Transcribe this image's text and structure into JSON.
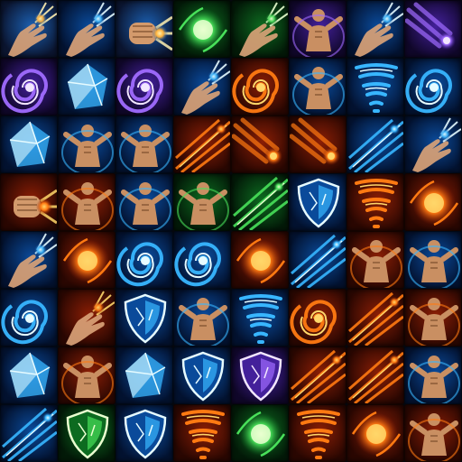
{
  "atlas": {
    "columns": 8,
    "rows": 8,
    "icons": [
      {
        "name": "palm-strike-icon",
        "theme": "lightning",
        "motif": "hand"
      },
      {
        "name": "air-palm-icon",
        "theme": "ice",
        "motif": "hand"
      },
      {
        "name": "golden-fist-icon",
        "theme": "lightning",
        "motif": "fist"
      },
      {
        "name": "green-orb-icon",
        "theme": "nature",
        "motif": "orb"
      },
      {
        "name": "green-grasp-icon",
        "theme": "nature",
        "motif": "hand"
      },
      {
        "name": "spirit-figure-icon",
        "theme": "arcane",
        "motif": "figure"
      },
      {
        "name": "open-hand-glow-icon",
        "theme": "ice",
        "motif": "hand"
      },
      {
        "name": "meteor-streak-icon",
        "theme": "arcane",
        "motif": "meteor"
      },
      {
        "name": "purple-wind-icon",
        "theme": "arcane",
        "motif": "swirl"
      },
      {
        "name": "crystal-cube-icon",
        "theme": "ice",
        "motif": "crystal"
      },
      {
        "name": "violet-vortex-icon",
        "theme": "arcane",
        "motif": "swirl"
      },
      {
        "name": "fingertip-light-icon",
        "theme": "ice",
        "motif": "hand"
      },
      {
        "name": "fire-whirl-icon",
        "theme": "fire",
        "motif": "swirl"
      },
      {
        "name": "monk-aura-icon",
        "theme": "ice",
        "motif": "figure"
      },
      {
        "name": "ice-tornado-icon",
        "theme": "ice",
        "motif": "tornado"
      },
      {
        "name": "water-vortex-icon",
        "theme": "ice",
        "motif": "swirl"
      },
      {
        "name": "ice-shards-icon",
        "theme": "ice",
        "motif": "crystal"
      },
      {
        "name": "meditation-icon",
        "theme": "ice",
        "motif": "figure"
      },
      {
        "name": "flying-kick-icon",
        "theme": "ice",
        "motif": "figure"
      },
      {
        "name": "fire-lines-icon",
        "theme": "fire",
        "motif": "streaks"
      },
      {
        "name": "fire-rain-icon",
        "theme": "fire",
        "motif": "meteor"
      },
      {
        "name": "meteor-shower-icon",
        "theme": "fire",
        "motif": "meteor"
      },
      {
        "name": "frost-lances-icon",
        "theme": "ice",
        "motif": "streaks"
      },
      {
        "name": "lightning-hand-icon",
        "theme": "ice",
        "motif": "hand"
      },
      {
        "name": "fire-punch-icon",
        "theme": "fire",
        "motif": "fist"
      },
      {
        "name": "fire-chest-icon",
        "theme": "fire",
        "motif": "figure"
      },
      {
        "name": "frost-chest-icon",
        "theme": "ice",
        "motif": "figure"
      },
      {
        "name": "nature-chest-icon",
        "theme": "nature",
        "motif": "figure"
      },
      {
        "name": "lightning-strike-icon",
        "theme": "nature",
        "motif": "streaks"
      },
      {
        "name": "blue-shield-icon",
        "theme": "ice",
        "motif": "shield"
      },
      {
        "name": "fire-pillar-icon",
        "theme": "fire",
        "motif": "tornado"
      },
      {
        "name": "fire-sun-icon",
        "theme": "fire",
        "motif": "orb"
      },
      {
        "name": "frost-grab-icon",
        "theme": "ice",
        "motif": "hand"
      },
      {
        "name": "fireball-icon",
        "theme": "fire",
        "motif": "orb"
      },
      {
        "name": "wave-ring-icon",
        "theme": "ice",
        "motif": "swirl"
      },
      {
        "name": "blue-cyclone-icon",
        "theme": "ice",
        "motif": "swirl"
      },
      {
        "name": "flame-burst-icon",
        "theme": "fire",
        "motif": "orb"
      },
      {
        "name": "blue-feathers-icon",
        "theme": "ice",
        "motif": "streaks"
      },
      {
        "name": "fire-monk-icon",
        "theme": "fire",
        "motif": "figure"
      },
      {
        "name": "frost-monk-icon",
        "theme": "ice",
        "motif": "figure"
      },
      {
        "name": "crescent-moon-icon",
        "theme": "ice",
        "motif": "swirl"
      },
      {
        "name": "crescent-blade-icon",
        "theme": "fire",
        "motif": "hand"
      },
      {
        "name": "broken-shield-icon",
        "theme": "ice",
        "motif": "shield"
      },
      {
        "name": "twin-spirits-icon",
        "theme": "ice",
        "motif": "figure"
      },
      {
        "name": "storm-twister-icon",
        "theme": "ice",
        "motif": "tornado"
      },
      {
        "name": "fire-spiral-icon",
        "theme": "fire",
        "motif": "swirl"
      },
      {
        "name": "fire-slashes-icon",
        "theme": "fire",
        "motif": "streaks"
      },
      {
        "name": "rolling-monk-icon",
        "theme": "fire",
        "motif": "figure"
      },
      {
        "name": "shattered-box-icon",
        "theme": "ice",
        "motif": "crystal"
      },
      {
        "name": "stance-monk-icon",
        "theme": "fire",
        "motif": "figure"
      },
      {
        "name": "frozen-shell-icon",
        "theme": "ice",
        "motif": "crystal"
      },
      {
        "name": "frost-shield-icon",
        "theme": "ice",
        "motif": "shield"
      },
      {
        "name": "cracked-shield-icon",
        "theme": "arcane",
        "motif": "shield"
      },
      {
        "name": "fire-strike-icon",
        "theme": "fire",
        "motif": "streaks"
      },
      {
        "name": "fire-dash-icon",
        "theme": "fire",
        "motif": "streaks"
      },
      {
        "name": "kick-monk-icon",
        "theme": "ice",
        "motif": "figure"
      },
      {
        "name": "light-beam-icon",
        "theme": "ice",
        "motif": "streaks"
      },
      {
        "name": "emerald-shield-icon",
        "theme": "nature",
        "motif": "shield"
      },
      {
        "name": "spark-shield-icon",
        "theme": "ice",
        "motif": "shield"
      },
      {
        "name": "flame-wall-icon",
        "theme": "fire",
        "motif": "tornado"
      },
      {
        "name": "green-flash-icon",
        "theme": "nature",
        "motif": "orb"
      },
      {
        "name": "fire-tornado-icon",
        "theme": "fire",
        "motif": "tornado"
      },
      {
        "name": "flame-orb-hand-icon",
        "theme": "fire",
        "motif": "orb"
      },
      {
        "name": "golden-avatar-icon",
        "theme": "fire",
        "motif": "figure"
      }
    ]
  },
  "colors": {
    "fire": [
      "#2a0702",
      "#8a1e05",
      "#ff7a12",
      "#ffd76a"
    ],
    "ice": [
      "#031230",
      "#0a4a9a",
      "#38b6ff",
      "#e6fbff"
    ],
    "nature": [
      "#031a08",
      "#0d6b20",
      "#49e05a",
      "#eaffd0"
    ],
    "lightning": [
      "#0b1530",
      "#1b5fb0",
      "#ffb13a",
      "#fff0b0"
    ],
    "arcane": [
      "#10072a",
      "#43209a",
      "#a06bff",
      "#f2e6ff"
    ]
  }
}
